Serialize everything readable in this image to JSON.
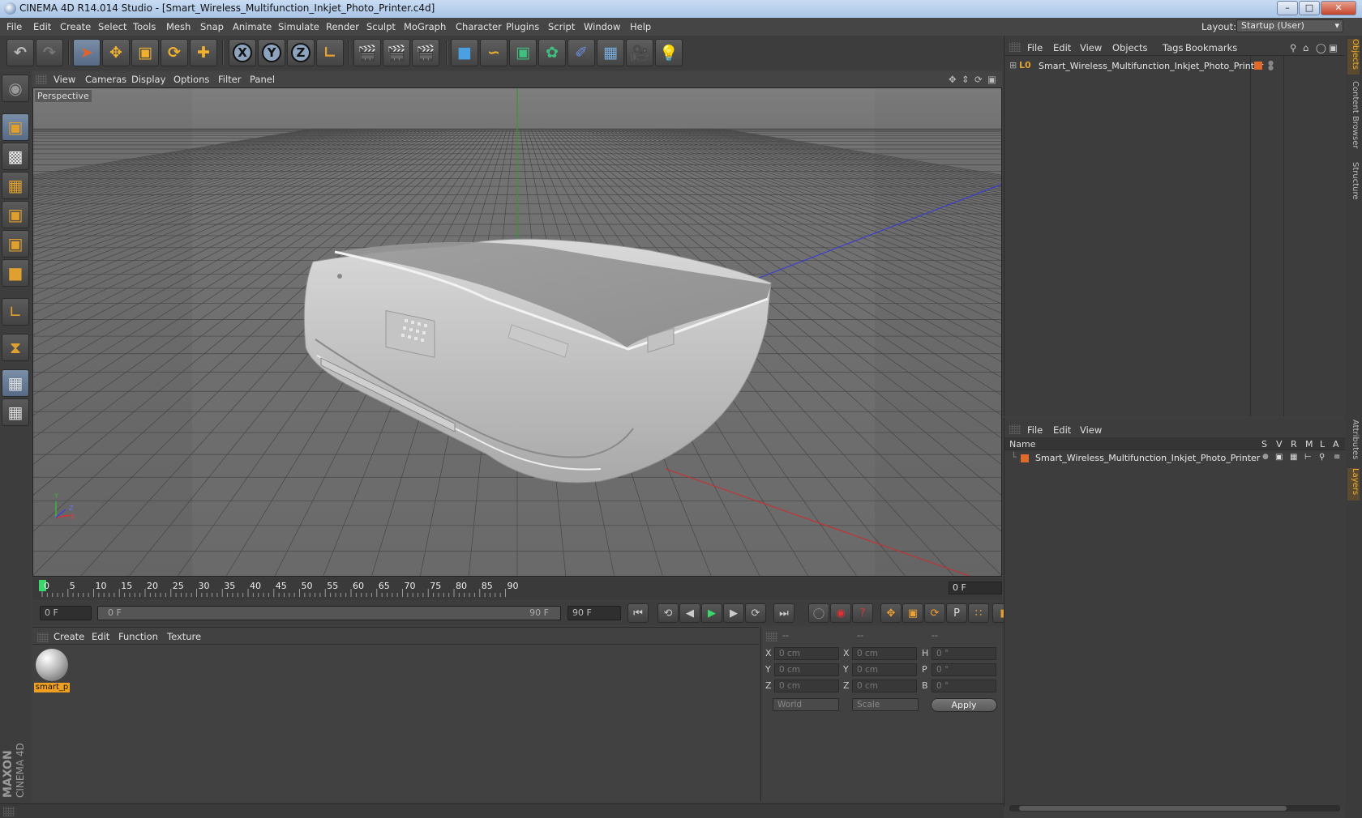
{
  "window": {
    "title": "CINEMA 4D R14.014 Studio - [Smart_Wireless_Multifunction_Inkjet_Photo_Printer.c4d]",
    "minimize": "–",
    "maximize": "□",
    "close": "✕"
  },
  "menu": [
    "File",
    "Edit",
    "Create",
    "Select",
    "Tools",
    "Mesh",
    "Snap",
    "Animate",
    "Simulate",
    "Render",
    "Sculpt",
    "MoGraph",
    "Character",
    "Plugins",
    "Script",
    "Window",
    "Help"
  ],
  "layout": {
    "label": "Layout:",
    "value": "Startup (User)"
  },
  "toolbar": {
    "x_label": "X",
    "y_label": "Y",
    "z_label": "Z"
  },
  "viewport": {
    "menu": [
      "View",
      "Cameras",
      "Display",
      "Options",
      "Filter",
      "Panel"
    ],
    "label": "Perspective",
    "axis_y": "Y",
    "axis_z": "Z",
    "axis_x": "X"
  },
  "timeline": {
    "ticks": [
      "0",
      "5",
      "10",
      "15",
      "20",
      "25",
      "30",
      "35",
      "40",
      "45",
      "50",
      "55",
      "60",
      "65",
      "70",
      "75",
      "80",
      "85",
      "90"
    ],
    "current_frame": "0 F",
    "start_field": "0 F",
    "range_start": "0 F",
    "range_end": "90 F",
    "end_field": "90 F"
  },
  "materials": {
    "menu": [
      "Create",
      "Edit",
      "Function",
      "Texture"
    ],
    "items": [
      {
        "name": "smart_p"
      }
    ]
  },
  "coordinates": {
    "headers": [
      "--",
      "--",
      "--"
    ],
    "rows": [
      {
        "pos_label": "X",
        "pos": "0 cm",
        "size_label": "X",
        "size": "0 cm",
        "rot_label": "H",
        "rot": "0 °"
      },
      {
        "pos_label": "Y",
        "pos": "0 cm",
        "size_label": "Y",
        "size": "0 cm",
        "rot_label": "P",
        "rot": "0 °"
      },
      {
        "pos_label": "Z",
        "pos": "0 cm",
        "size_label": "Z",
        "size": "0 cm",
        "rot_label": "B",
        "rot": "0 °"
      }
    ],
    "mode": "World",
    "scale": "Scale",
    "apply": "Apply"
  },
  "objects": {
    "menu": [
      "File",
      "Edit",
      "View",
      "Objects",
      "Tags",
      "Bookmarks"
    ],
    "items": [
      {
        "name": "Smart_Wireless_Multifunction_Inkjet_Photo_Printer",
        "color": "#e06a2a"
      }
    ]
  },
  "layers": {
    "menu": [
      "File",
      "Edit",
      "View"
    ],
    "columns": [
      "Name",
      "S",
      "V",
      "R",
      "M",
      "L",
      "A"
    ],
    "items": [
      {
        "name": "Smart_Wireless_Multifunction_Inkjet_Photo_Printer",
        "color": "#e06a2a"
      }
    ]
  },
  "side_tabs": [
    "Objects",
    "Content Browser",
    "Structure",
    "Attributes",
    "Layers"
  ],
  "branding": {
    "maxon": "MAXON",
    "cinema": "CINEMA 4D"
  }
}
